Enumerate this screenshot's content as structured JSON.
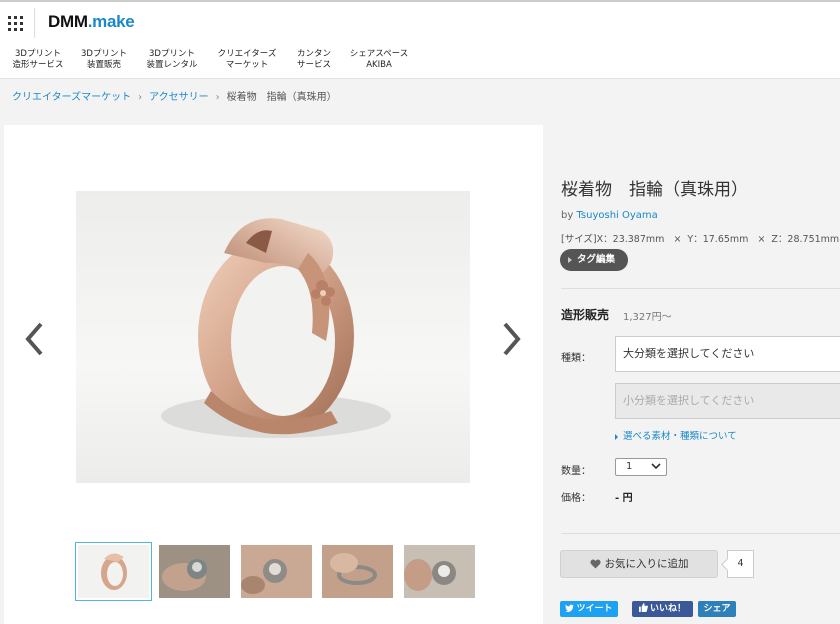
{
  "header": {
    "logo_part1": "DMM",
    "logo_part2": ".make",
    "nav": [
      {
        "label": "3Dプリント\n造形サービス"
      },
      {
        "label": "3Dプリント\n装置販売"
      },
      {
        "label": "3Dプリント\n装置レンタル"
      },
      {
        "label": "クリエイターズ\nマーケット"
      },
      {
        "label": "カンタン\nサービス"
      },
      {
        "label": "シェアスペース\nAKIBA"
      }
    ]
  },
  "breadcrumb": {
    "items": [
      "クリエイターズマーケット",
      "アクセサリー"
    ],
    "current": "桜着物　指輪（真珠用）",
    "separator": "›"
  },
  "gallery": {
    "prev_icon": "chevron-left-icon",
    "next_icon": "chevron-right-icon",
    "thumbnail_count": 5,
    "active_thumbnail": 1
  },
  "product": {
    "title": "桜着物　指輪（真珠用）",
    "by_prefix": "by",
    "author": "Tsuyoshi Oyama",
    "size_label": "[サイズ]",
    "size_x": "X：23.387mm",
    "size_y": "Y：17.65mm",
    "size_z": "Z：28.751mm",
    "size_times": "×",
    "tag_button": "タグ編集"
  },
  "purchase": {
    "sale_label": "造形販売",
    "sale_price": "1,327円〜",
    "type_label": "種類：",
    "category_placeholder": "大分類を選択してください",
    "subcategory_placeholder": "小分類を選択してください",
    "materials_link": "選べる素材・種類について",
    "quantity_label": "数量：",
    "quantity_value": "1",
    "price_label": "価格：",
    "price_value": "- 円"
  },
  "social": {
    "favorite_label": "お気に入りに追加",
    "favorite_count": "4",
    "tweet_label": "ツイート",
    "like_label": "いいね！",
    "share_label": "シェア"
  },
  "colors": {
    "link": "#1a88c9",
    "twitter": "#1da1f2",
    "facebook": "#3b5998",
    "share": "#2e80b8",
    "ring_gold": "#d5a58c"
  }
}
